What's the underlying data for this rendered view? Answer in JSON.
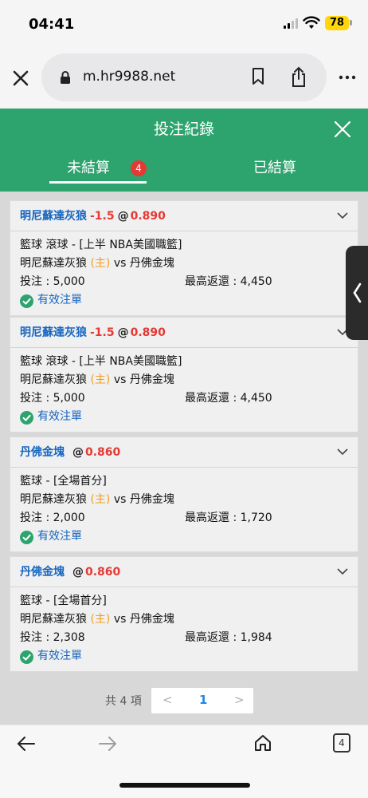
{
  "status": {
    "time": "04:41",
    "battery": "78"
  },
  "browser": {
    "url": "m.hr9988.net",
    "tab_count": "4"
  },
  "app": {
    "title": "投注紀錄",
    "tabs": [
      {
        "label": "未結算",
        "badge": "4",
        "active": true
      },
      {
        "label": "已結算",
        "active": false
      }
    ]
  },
  "bets": [
    {
      "team": "明尼蘇達灰狼",
      "handicap": "-1.5",
      "at": "@",
      "odds": "0.890",
      "league": "籃球 滾球 - [上半 NBA美國職籃]",
      "home": "明尼蘇達灰狼",
      "home_tag": "(主)",
      "vs": "vs",
      "away": "丹佛金塊",
      "stake": "投注 : 5,000",
      "max_return": "最高返還 : 4,450",
      "status": "有效注單"
    },
    {
      "team": "明尼蘇達灰狼",
      "handicap": "-1.5",
      "at": "@",
      "odds": "0.890",
      "league": "籃球 滾球 - [上半 NBA美國職籃]",
      "home": "明尼蘇達灰狼",
      "home_tag": "(主)",
      "vs": "vs",
      "away": "丹佛金塊",
      "stake": "投注 : 5,000",
      "max_return": "最高返還 : 4,450",
      "status": "有效注單"
    },
    {
      "team": "丹佛金塊",
      "handicap": "",
      "at": "@",
      "odds": "0.860",
      "league": "籃球 - [全場首分]",
      "home": "明尼蘇達灰狼",
      "home_tag": "(主)",
      "vs": "vs",
      "away": "丹佛金塊",
      "stake": "投注 : 2,000",
      "max_return": "最高返還 : 1,720",
      "status": "有效注單"
    },
    {
      "team": "丹佛金塊",
      "handicap": "",
      "at": "@",
      "odds": "0.860",
      "league": "籃球 - [全場首分]",
      "home": "明尼蘇達灰狼",
      "home_tag": "(主)",
      "vs": "vs",
      "away": "丹佛金塊",
      "stake": "投注 : 2,308",
      "max_return": "最高返還 : 1,984",
      "status": "有效注單"
    }
  ],
  "pager": {
    "total": "共 4 項",
    "prev": "<",
    "page": "1",
    "next": ">"
  },
  "colors": {
    "header": "#2da36e",
    "team": "#1565c0",
    "odds": "#e53935",
    "home_tag": "#f0a020"
  }
}
